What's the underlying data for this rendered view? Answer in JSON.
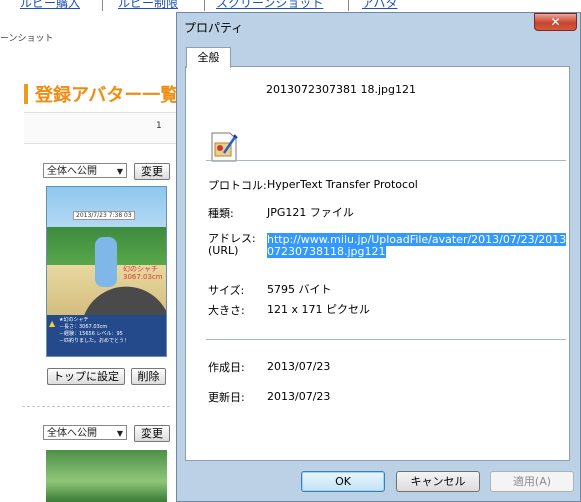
{
  "background_page": {
    "nav": [
      "ルビー購入",
      "ルビー制限",
      "スクリーンショット",
      "アバタ"
    ],
    "breadcrumb": "ーンショット",
    "page_title": "登録アバター一覧",
    "count": "1",
    "visibility_select": "全体へ公開",
    "change_button": "変更",
    "set_top_button": "トップに設定",
    "delete_button": "削除",
    "avatar_time": "2013/7/23  7:38  03",
    "avatar_name_line1": "幻のシャチ",
    "avatar_name_line2": "3067.03cm",
    "avatar_info": [
      "★幻のシャチ",
      "－長さ：3067.03cm",
      "－経験：15656 レベル：95",
      "－匹釣りました。おめでとう！"
    ]
  },
  "dialog": {
    "title": "プロパティ",
    "close_glyph": "✕",
    "tab": "全般",
    "file_name": "2013072307381 18.jpg121",
    "fields": {
      "protocol_label": "プロトコル:",
      "protocol_value": "HyperText Transfer Protocol",
      "type_label": "種類:",
      "type_value": "JPG121 ファイル",
      "address_label_1": "アドレス:",
      "address_label_2": "(URL)",
      "address_value_1": "http://www.milu.jp/UploadFile/avater/2013/07/23/2013",
      "address_value_2": "07230738118.jpg121",
      "size_label": "サイズ:",
      "size_value": "5795 バイト",
      "dimensions_label": "大きさ:",
      "dimensions_value": "121  x  171  ピクセル",
      "created_label": "作成日:",
      "created_value": "2013/07/23",
      "modified_label": "更新日:",
      "modified_value": "2013/07/23"
    },
    "buttons": {
      "ok": "OK",
      "cancel": "キャンセル",
      "apply": "適用(A)"
    }
  },
  "colors": {
    "link": "#1d4fb8",
    "title_orange": "#f08c10",
    "selection": "#3399ff",
    "dialog_frame": "#bcd0e6",
    "close_red": "#c8442f"
  }
}
